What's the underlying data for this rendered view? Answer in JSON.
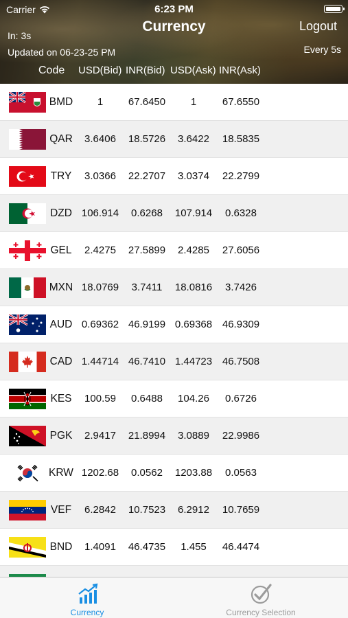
{
  "status_bar": {
    "carrier": "Carrier",
    "time": "6:23 PM"
  },
  "nav": {
    "title": "Currency",
    "logout_label": "Logout",
    "refresh_in": "In: 3s",
    "updated": "Updated on 06-23-25 PM",
    "interval": "Every 5s"
  },
  "columns": [
    "Code",
    "USD(Bid)",
    "INR(Bid)",
    "USD(Ask)",
    "INR(Ask)"
  ],
  "rows": [
    {
      "code": "BMD",
      "usd_bid": "1",
      "inr_bid": "67.6450",
      "usd_ask": "1",
      "inr_ask": "67.6550",
      "flag": "bermuda"
    },
    {
      "code": "QAR",
      "usd_bid": "3.6406",
      "inr_bid": "18.5726",
      "usd_ask": "3.6422",
      "inr_ask": "18.5835",
      "flag": "qatar"
    },
    {
      "code": "TRY",
      "usd_bid": "3.0366",
      "inr_bid": "22.2707",
      "usd_ask": "3.0374",
      "inr_ask": "22.2799",
      "flag": "turkey"
    },
    {
      "code": "DZD",
      "usd_bid": "106.914",
      "inr_bid": "0.6268",
      "usd_ask": "107.914",
      "inr_ask": "0.6328",
      "flag": "algeria"
    },
    {
      "code": "GEL",
      "usd_bid": "2.4275",
      "inr_bid": "27.5899",
      "usd_ask": "2.4285",
      "inr_ask": "27.6056",
      "flag": "georgia"
    },
    {
      "code": "MXN",
      "usd_bid": "18.0769",
      "inr_bid": "3.7411",
      "usd_ask": "18.0816",
      "inr_ask": "3.7426",
      "flag": "mexico"
    },
    {
      "code": "AUD",
      "usd_bid": "0.69362",
      "inr_bid": "46.9199",
      "usd_ask": "0.69368",
      "inr_ask": "46.9309",
      "flag": "australia"
    },
    {
      "code": "CAD",
      "usd_bid": "1.44714",
      "inr_bid": "46.7410",
      "usd_ask": "1.44723",
      "inr_ask": "46.7508",
      "flag": "canada"
    },
    {
      "code": "KES",
      "usd_bid": "100.59",
      "inr_bid": "0.6488",
      "usd_ask": "104.26",
      "inr_ask": "0.6726",
      "flag": "kenya"
    },
    {
      "code": "PGK",
      "usd_bid": "2.9417",
      "inr_bid": "21.8994",
      "usd_ask": "3.0889",
      "inr_ask": "22.9986",
      "flag": "papua-new-guinea"
    },
    {
      "code": "KRW",
      "usd_bid": "1202.68",
      "inr_bid": "0.0562",
      "usd_ask": "1203.88",
      "inr_ask": "0.0563",
      "flag": "south-korea"
    },
    {
      "code": "VEF",
      "usd_bid": "6.2842",
      "inr_bid": "10.7523",
      "usd_ask": "6.2912",
      "inr_ask": "10.7659",
      "flag": "venezuela"
    },
    {
      "code": "BND",
      "usd_bid": "1.4091",
      "inr_bid": "46.4735",
      "usd_ask": "1.455",
      "inr_ask": "46.4474",
      "flag": "brunei"
    },
    {
      "code": "",
      "usd_bid": "",
      "inr_bid": "",
      "usd_ask": "",
      "inr_ask": "",
      "flag": "partial-green"
    }
  ],
  "tabs": [
    {
      "label": "Currency",
      "icon": "chart-icon",
      "active": true
    },
    {
      "label": "Currency Selection",
      "icon": "checkmark-icon",
      "active": false
    }
  ],
  "colors": {
    "active_tab": "#1a8fe3",
    "inactive_tab": "#9b9b9b",
    "row_alt": "#f0f0f0"
  }
}
